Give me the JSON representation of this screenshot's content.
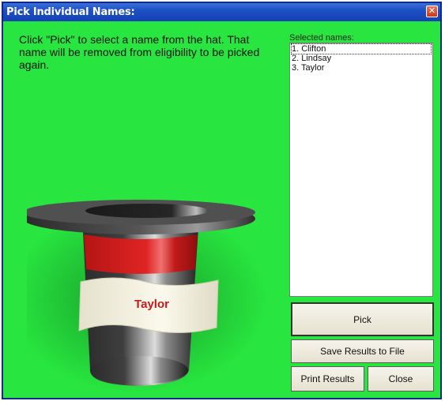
{
  "window": {
    "title": "Pick Individual Names:",
    "close_glyph": "✕"
  },
  "instructions": "Click \"Pick\" to select a name from the hat. That name will be removed from eligibility to be picked again.",
  "selected_names": {
    "label": "Selected names:",
    "items": [
      "1. Clifton",
      "2. Lindsay",
      "3. Taylor"
    ]
  },
  "hat": {
    "current_name": "Taylor",
    "band_color": "#d91f1f",
    "name_color": "#c41a1a"
  },
  "buttons": {
    "pick": "Pick",
    "save": "Save Results to File",
    "print": "Print Results",
    "close": "Close"
  },
  "colors": {
    "background": "#28e63f",
    "titlebar": "#1d4fc4"
  }
}
